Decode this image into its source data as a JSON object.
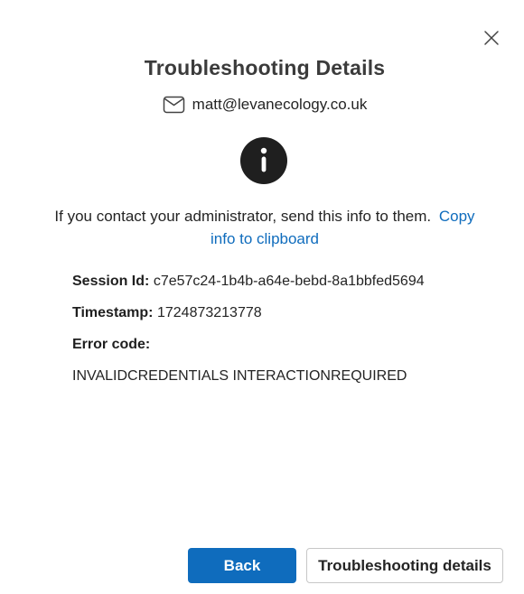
{
  "dialog": {
    "title": "Troubleshooting Details",
    "account_email": "matt@levanecology.co.uk",
    "message": "If you contact your administrator, send this info to them.",
    "copy_link_label": "Copy info to clipboard"
  },
  "details": {
    "session_label": "Session Id:",
    "session_value": "c7e57c24-1b4b-a64e-bebd-8a1bbfed5694",
    "timestamp_label": "Timestamp:",
    "timestamp_value": "1724873213778",
    "error_label": "Error code:",
    "error_value": "INVALIDCREDENTIALS INTERACTIONREQUIRED"
  },
  "buttons": {
    "back_label": "Back",
    "troubleshooting_label": "Troubleshooting details"
  },
  "icons": {
    "close": "close-icon",
    "mail": "mail-icon",
    "info": "info-icon"
  },
  "colors": {
    "accent": "#0f6cbd",
    "info_circle": "#1f1f1f"
  }
}
